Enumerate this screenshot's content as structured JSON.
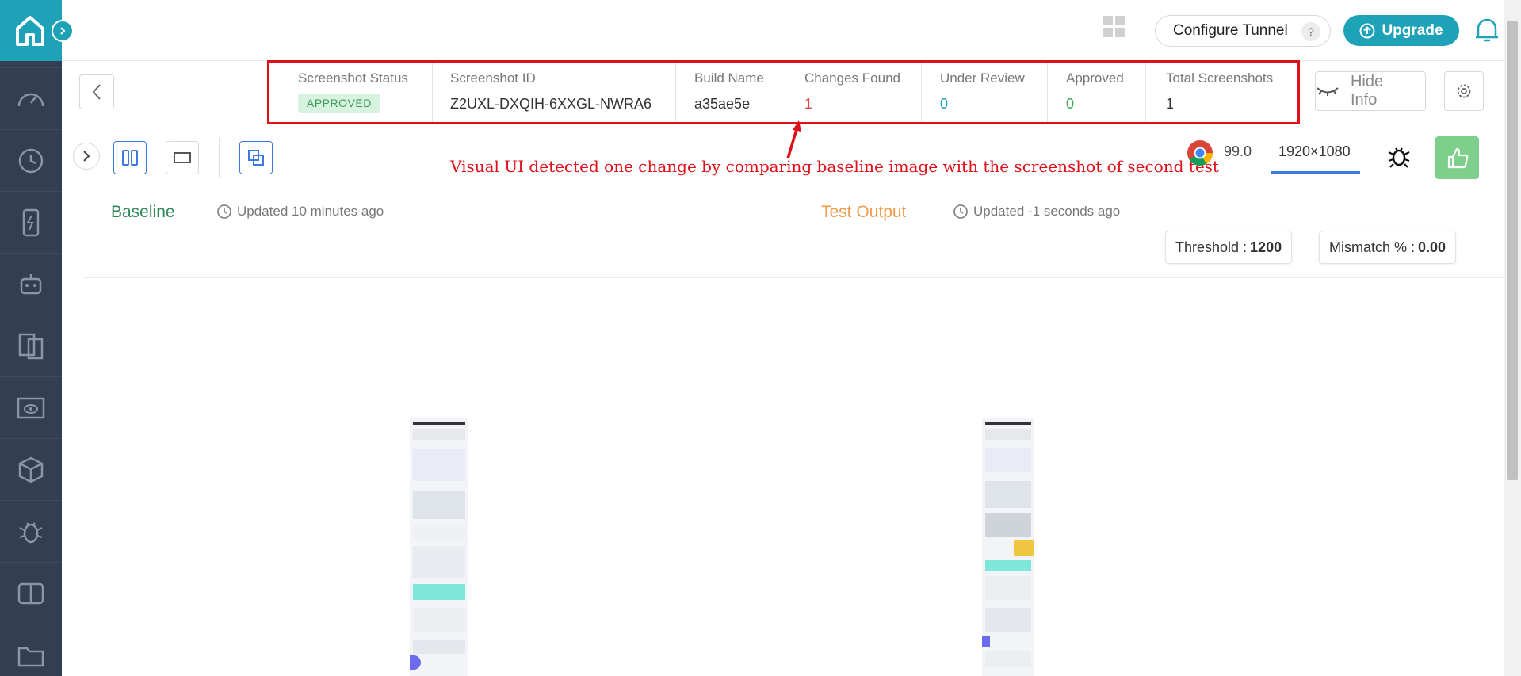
{
  "topbar": {
    "configure_tunnel_label": "Configure Tunnel",
    "help_badge": "?",
    "upgrade_label": "Upgrade"
  },
  "info": {
    "screenshot_status_label": "Screenshot Status",
    "screenshot_status_value": "APPROVED",
    "screenshot_id_label": "Screenshot ID",
    "screenshot_id_value": "Z2UXL-DXQIH-6XXGL-NWRA6",
    "build_name_label": "Build Name",
    "build_name_value": "a35ae5e",
    "changes_found_label": "Changes Found",
    "changes_found_value": "1",
    "under_review_label": "Under Review",
    "under_review_value": "0",
    "approved_label": "Approved",
    "approved_value": "0",
    "total_screenshots_label": "Total Screenshots",
    "total_screenshots_value": "1",
    "hide_info_label": "Hide Info"
  },
  "annotation": "Visual UI detected one change by comparing baseline image with the screenshot of second test",
  "toolbar": {
    "browser_version": "99.0",
    "resolution": "1920×1080"
  },
  "baseline": {
    "title": "Baseline",
    "updated": "Updated 10 minutes ago"
  },
  "test_output": {
    "title": "Test Output",
    "updated": "Updated -1 seconds ago",
    "threshold_label": "Threshold :",
    "threshold_value": "1200",
    "mismatch_label": "Mismatch % :",
    "mismatch_value": "0.00"
  },
  "colors": {
    "sidebar": "#333e52",
    "accent": "#1ea2b8",
    "highlight_box": "#e0101a",
    "approved_green": "#3ba659",
    "changes_red": "#e8464b"
  }
}
